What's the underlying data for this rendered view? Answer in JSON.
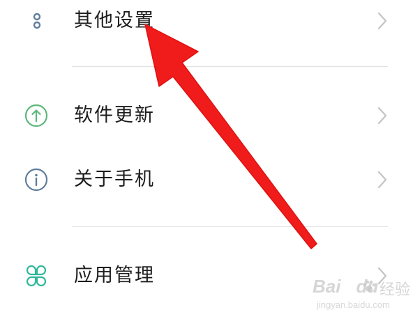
{
  "settings_list": {
    "items": [
      {
        "label": "其他设置",
        "icon": "more-dots-icon"
      },
      {
        "label": "软件更新",
        "icon": "upload-arrow-icon"
      },
      {
        "label": "关于手机",
        "icon": "info-icon"
      },
      {
        "label": "应用管理",
        "icon": "apps-grid-icon"
      }
    ]
  },
  "colors": {
    "dots_icon": "#607d9c",
    "update_icon": "#5cb87a",
    "info_icon": "#607d9c",
    "apps_icon": "#2fb89a",
    "chevron": "#c4c4c4",
    "arrow": "#f01c1c",
    "divider": "#e2e2e2"
  },
  "watermark": {
    "brand": "Bai",
    "brand_suffix": "du",
    "cn": "经验",
    "url": "jingyan.baidu.com"
  }
}
